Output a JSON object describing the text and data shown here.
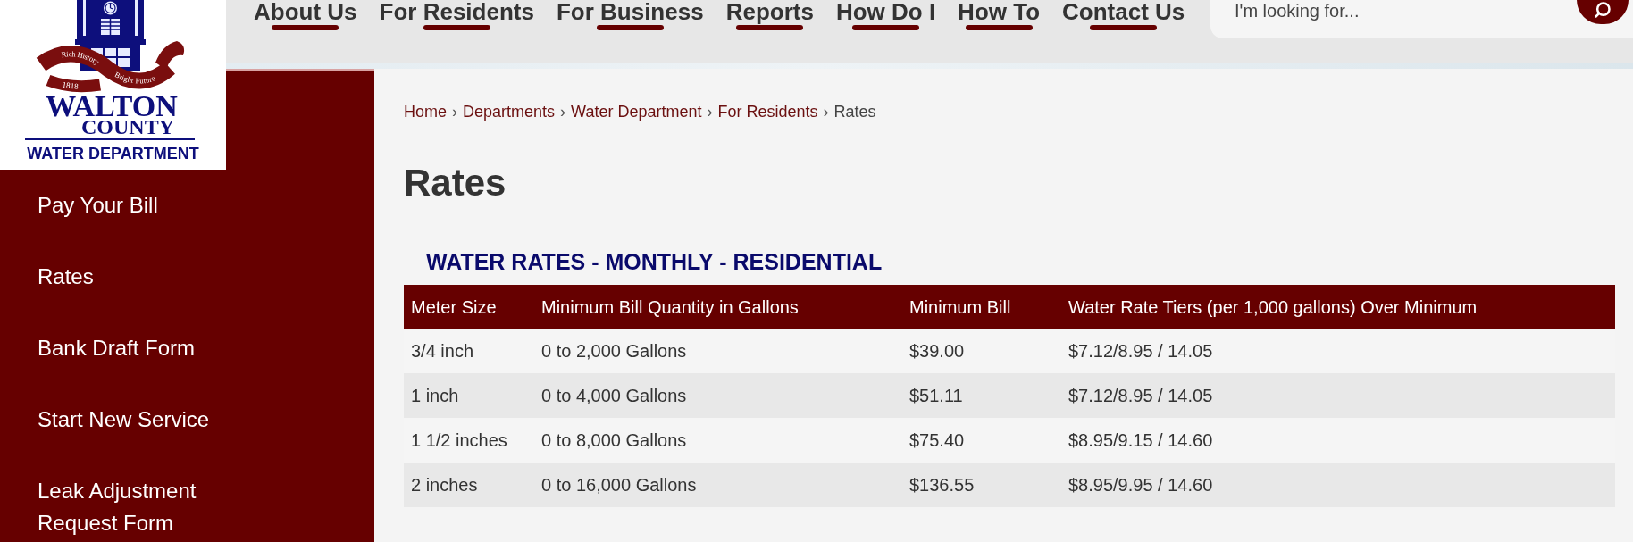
{
  "logo": {
    "ribbon_texts": [
      "Rich History",
      "Bright Future"
    ],
    "year": "1818",
    "name_lines": [
      "WALTON",
      "COUNTY"
    ],
    "department": "WATER DEPARTMENT"
  },
  "nav": [
    "About Us",
    "For Residents",
    "For Business",
    "Reports",
    "How Do I",
    "How To",
    "Contact Us"
  ],
  "search": {
    "placeholder": "I'm looking for..."
  },
  "sidebar": {
    "items": [
      "Pay Your Bill",
      "Rates",
      "Bank Draft Form",
      "Start New Service",
      "Leak Adjustment Request Form"
    ]
  },
  "breadcrumb": [
    {
      "label": "Home",
      "current": false
    },
    {
      "separator": "›",
      "label": "Departments",
      "current": false
    },
    {
      "separator": "›",
      "label": "Water Department",
      "current": false
    },
    {
      "separator": "›",
      "label": "For Residents",
      "current": false
    },
    {
      "separator": "›",
      "label": "Rates",
      "current": true
    }
  ],
  "page_title": "Rates",
  "section_heading": "WATER RATES - MONTHLY - RESIDENTIAL",
  "table": {
    "columns": [
      "Meter Size",
      "Minimum Bill Quantity in Gallons",
      "Minimum Bill",
      "Water Rate Tiers (per 1,000 gallons) Over Minimum"
    ],
    "rows": [
      [
        "3/4 inch",
        "0 to 2,000 Gallons",
        "$39.00",
        "$7.12/8.95 / 14.05"
      ],
      [
        "1 inch",
        "0 to 4,000 Gallons",
        "$51.11",
        "$7.12/8.95 / 14.05"
      ],
      [
        "1 1/2 inches",
        "0 to 8,000 Gallons",
        "$75.40",
        "$8.95/9.15 / 14.60"
      ],
      [
        "2 inches",
        "0 to 16,000 Gallons",
        "$136.55",
        "$8.95/9.95 / 14.60"
      ]
    ]
  }
}
